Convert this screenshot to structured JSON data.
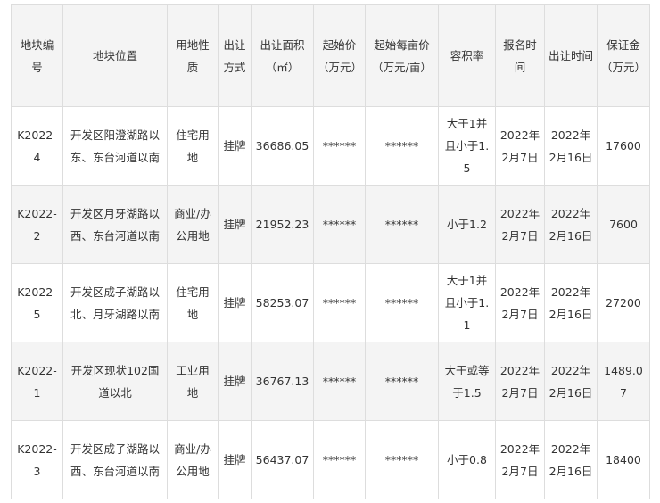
{
  "table": {
    "headers": [
      "地块编号",
      "地块位置",
      "用地性质",
      "出让方式",
      "出让面积（㎡）",
      "起始价（万元）",
      "起始每亩价（万元/亩）",
      "容积率",
      "报名时间",
      "出让时间",
      "保证金（万元）"
    ],
    "rows": [
      [
        "K2022-4",
        "开发区阳澄湖路以东、东台河道以南",
        "住宅用地",
        "挂牌",
        "36686.05",
        "******",
        "******",
        "大于1并且小于1.5",
        "2022年2月7日",
        "2022年2月16日",
        "17600"
      ],
      [
        "K2022-2",
        "开发区月牙湖路以西、东台河道以南",
        "商业/办公用地",
        "挂牌",
        "21952.23",
        "******",
        "******",
        "小于1.2",
        "2022年2月7日",
        "2022年2月16日",
        "7600"
      ],
      [
        "K2022-5",
        "开发区成子湖路以北、月牙湖路以南",
        "住宅用地",
        "挂牌",
        "58253.07",
        "******",
        "******",
        "大于1并且小于1.1",
        "2022年2月7日",
        "2022年2月16日",
        "27200"
      ],
      [
        "K2022-1",
        "开发区现状102国道以北",
        "工业用地",
        "挂牌",
        "36767.13",
        "******",
        "******",
        "大于或等于1.5",
        "2022年2月7日",
        "2022年2月16日",
        "1489.07"
      ],
      [
        "K2022-3",
        "开发区成子湖路以西、东台河道以南",
        "商业/办公用地",
        "挂牌",
        "56437.07",
        "******",
        "******",
        "小于0.8",
        "2022年2月7日",
        "2022年2月16日",
        "18400"
      ]
    ]
  }
}
